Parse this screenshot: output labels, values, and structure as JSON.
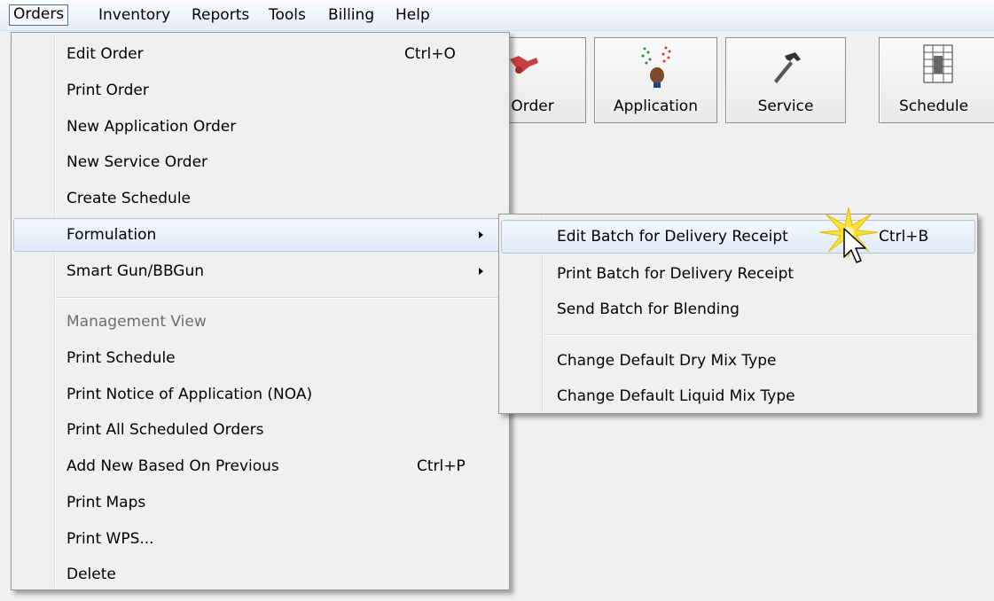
{
  "menubar": {
    "items": [
      "Orders",
      "Inventory",
      "Reports",
      "Tools",
      "Billing",
      "Help"
    ]
  },
  "toolbar": {
    "buttons": [
      {
        "label": "l Order",
        "icon": "tractor-icon"
      },
      {
        "label": "Application",
        "icon": "sprayer-icon"
      },
      {
        "label": "Service",
        "icon": "hammer-icon"
      },
      {
        "label": "Schedule",
        "icon": "schedule-icon"
      }
    ]
  },
  "orders_menu": {
    "items": [
      {
        "label": "Edit Order",
        "shortcut": "Ctrl+O"
      },
      {
        "label": "Print Order"
      },
      {
        "label": "New Application Order"
      },
      {
        "label": "New Service Order"
      },
      {
        "label": "Create Schedule"
      },
      {
        "label": "Formulation",
        "submenu": true
      },
      {
        "label": "Smart Gun/BBGun",
        "submenu": true
      },
      {
        "label": "Management View",
        "disabled": true
      },
      {
        "label": "Print Schedule"
      },
      {
        "label": "Print Notice of Application (NOA)"
      },
      {
        "label": "Print All Scheduled Orders"
      },
      {
        "label": "Add New Based On Previous",
        "shortcut": "Ctrl+P"
      },
      {
        "label": "Print Maps"
      },
      {
        "label": "Print WPS..."
      },
      {
        "label": "Delete"
      }
    ]
  },
  "formulation_menu": {
    "items": [
      {
        "label": "Edit Batch for Delivery Receipt",
        "shortcut": "Ctrl+B"
      },
      {
        "label": "Print Batch for Delivery Receipt"
      },
      {
        "label": "Send Batch for Blending"
      },
      {
        "label": "Change Default Dry Mix Type"
      },
      {
        "label": "Change Default Liquid Mix Type"
      }
    ]
  },
  "colors": {
    "highlight_border": "#a9c5ea",
    "highlight_fill": "#e0ebf8",
    "disabled_text": "#6d6d6d",
    "menu_bg": "#f0f0f0"
  }
}
